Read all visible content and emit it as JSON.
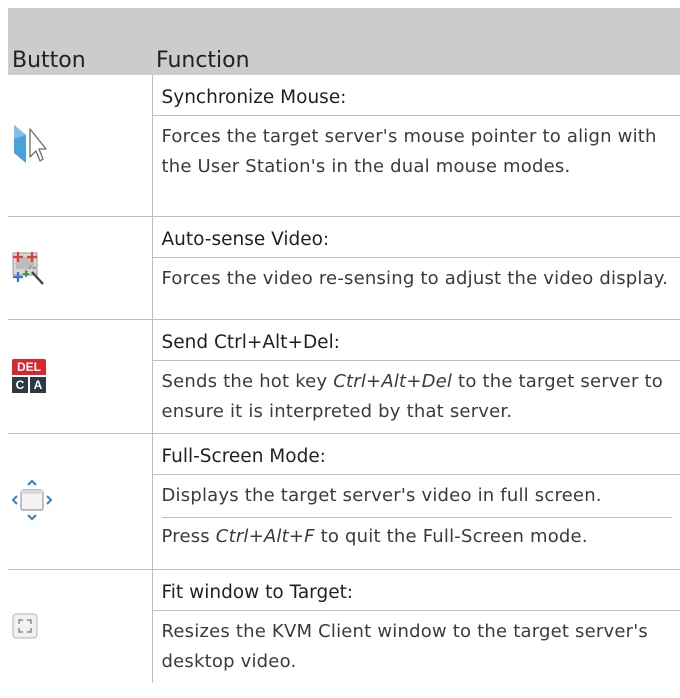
{
  "header": {
    "col_button": "Button",
    "col_function": "Function"
  },
  "rows": [
    {
      "icon": "mouse-pointer-icon",
      "name": "Synchronize Mouse",
      "description": "Forces the target server's mouse pointer to align with the User Station's in the dual mouse modes."
    },
    {
      "icon": "auto-sense-video-icon",
      "name": "Auto-sense Video",
      "description": "Forces the video re-sensing to adjust the video display."
    },
    {
      "icon": "ctrl-alt-del-icon",
      "name": "Send Ctrl+Alt+Del",
      "desc_pre": "Sends the hot key ",
      "desc_key": "Ctrl+Alt+Del",
      "desc_post": " to the target server to ensure it is interpreted by that server.",
      "icon_text_top": "DEL",
      "icon_text_left": "C",
      "icon_text_right": "A"
    },
    {
      "icon": "full-screen-icon",
      "name": "Full-Screen Mode",
      "description": "Displays the target server's video in full screen.",
      "desc2_pre": "Press ",
      "desc2_key": "Ctrl+Alt+F",
      "desc2_post": " to quit the Full-Screen mode."
    },
    {
      "icon": "fit-window-icon",
      "name": "Fit window to Target",
      "description": "Resizes the KVM Client window to the target server's desktop video."
    }
  ],
  "colon": ":",
  "colors": {
    "header_bg": "#cccccc",
    "rule": "#bdbdbd",
    "text": "#231f20",
    "del_red": "#d9262b",
    "ca_dark": "#2c3a46"
  }
}
